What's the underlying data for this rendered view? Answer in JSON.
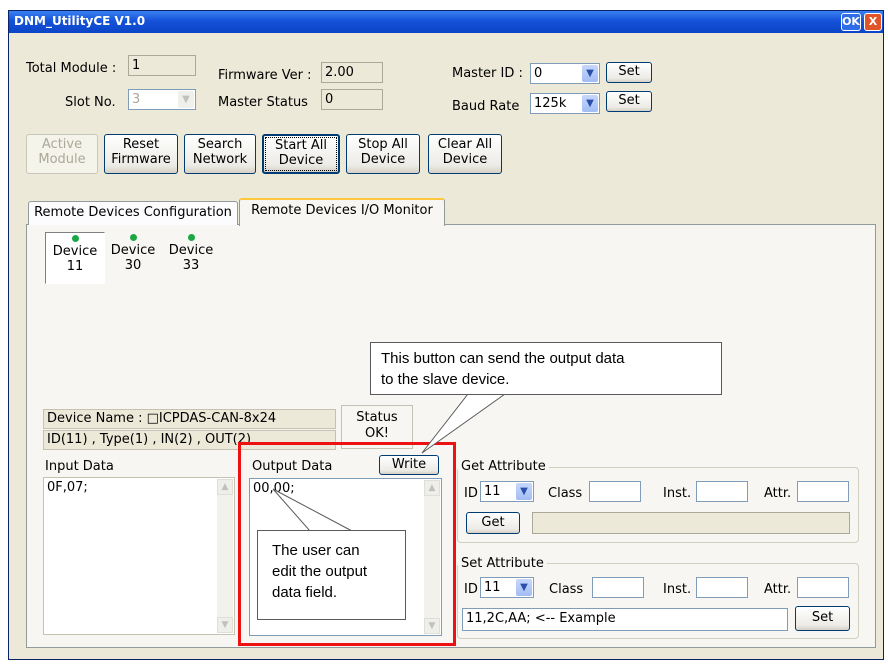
{
  "window": {
    "title": "DNM_UtilityCE V1.0",
    "ok_label": "OK",
    "close_label": "X"
  },
  "top": {
    "total_module_label": "Total Module :",
    "total_module_value": "1",
    "slot_label": "Slot No.",
    "slot_value": "3",
    "firmware_label": "Firmware Ver :",
    "firmware_value": "2.00",
    "master_status_label": "Master Status",
    "master_status_value": "0",
    "master_id_label": "Master ID :",
    "master_id_value": "0",
    "master_id_set": "Set",
    "baud_label": "Baud Rate",
    "baud_value": "125k",
    "baud_set": "Set"
  },
  "toolbar": [
    {
      "line1": "Active",
      "line2": "Module"
    },
    {
      "line1": "Reset",
      "line2": "Firmware"
    },
    {
      "line1": "Search",
      "line2": "Network"
    },
    {
      "line1": "Start All",
      "line2": "Device"
    },
    {
      "line1": "Stop All",
      "line2": "Device"
    },
    {
      "line1": "Clear All",
      "line2": "Device"
    }
  ],
  "tabs": [
    "Remote Devices Configuration",
    "Remote Devices I/O Monitor"
  ],
  "devices": [
    {
      "line1": "Device",
      "line2": "11"
    },
    {
      "line1": "Device",
      "line2": "30"
    },
    {
      "line1": "Device",
      "line2": "33"
    }
  ],
  "device_info": {
    "name": "Device Name : □ICPDAS-CAN-8x24",
    "ids": "ID(11) , Type(1) , IN(2) , OUT(2)",
    "status_label": "Status",
    "status_value": "OK!"
  },
  "io": {
    "input_label": "Input Data",
    "input_value": "0F,07;",
    "output_label": "Output Data",
    "output_value": "00,00;",
    "write_label": "Write"
  },
  "get_attr": {
    "group_label": "Get Attribute",
    "id_label": "ID",
    "id_value": "11",
    "class_label": "Class",
    "inst_label": "Inst.",
    "attr_label": "Attr.",
    "get_button": "Get"
  },
  "set_attr": {
    "group_label": "Set Attribute",
    "id_label": "ID",
    "id_value": "11",
    "class_label": "Class",
    "inst_label": "Inst.",
    "attr_label": "Attr.",
    "example_value": "11,2C,AA;    <-- Example",
    "set_button": "Set"
  },
  "callouts": {
    "write_note_1": "This button can send the output data",
    "write_note_2": "to the slave device.",
    "output_note_1": "The user can",
    "output_note_2": "edit the output",
    "output_note_3": "data field."
  },
  "colors": {
    "highlight_red": "#ee1111",
    "title_blue": "#1552d9",
    "status_green": "#1ba843"
  }
}
